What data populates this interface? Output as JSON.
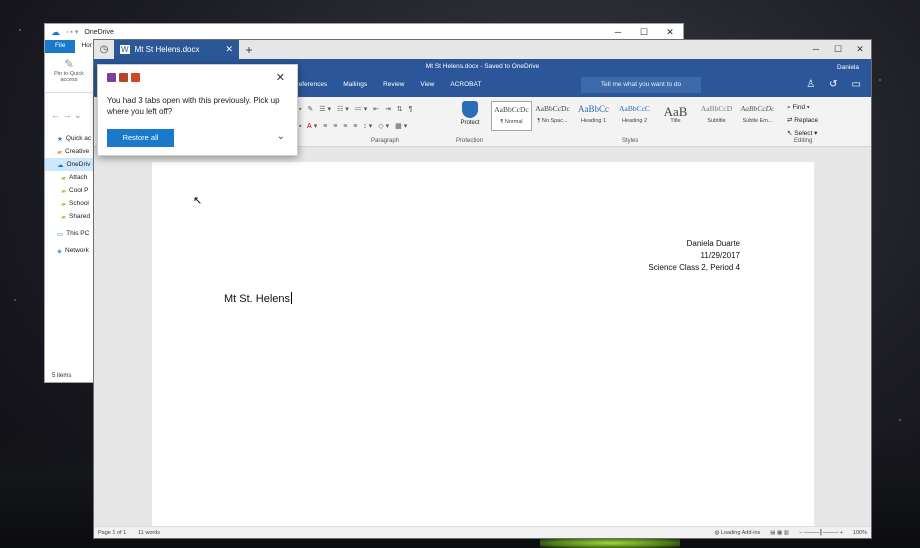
{
  "explorer": {
    "title": "OneDrive",
    "tab_file": "File",
    "tab_home": "Hor",
    "pin_label": "Pin to Quick access",
    "sidebar": [
      {
        "label": "Quick ac",
        "icon": "star-icon"
      },
      {
        "label": "Creative",
        "icon": "folder-icon"
      },
      {
        "label": "OneDriv",
        "icon": "cloud-icon",
        "selected": true
      },
      {
        "label": "Attach",
        "icon": "folder-icon"
      },
      {
        "label": "Cool P",
        "icon": "folder-icon"
      },
      {
        "label": "School",
        "icon": "folder-icon"
      },
      {
        "label": "Shared",
        "icon": "folder-icon"
      },
      {
        "label": "This PC",
        "icon": "pc-icon"
      },
      {
        "label": "Network",
        "icon": "network-icon"
      }
    ],
    "status": "5 items"
  },
  "word": {
    "tab_title": "Mt St Helens.docx",
    "doc_title": "Mt St Helens.docx - Saved to OneDrive",
    "user": "Daniela",
    "menus": [
      "References",
      "Mailings",
      "Review",
      "View",
      "ACROBAT"
    ],
    "tellme": "Tell me what you want to do",
    "groups": {
      "paragraph": "Paragraph",
      "protection": "Protection",
      "styles": "Styles",
      "editing": "Editing"
    },
    "protect_label": "Protect",
    "styles": [
      {
        "preview": "AaBbCcDc",
        "name": "¶ Normal"
      },
      {
        "preview": "AaBbCcDc",
        "name": "¶ No Spac..."
      },
      {
        "preview": "AaBbCc",
        "name": "Heading 1"
      },
      {
        "preview": "AaBbCcC",
        "name": "Heading 2"
      },
      {
        "preview": "AaB",
        "name": "Title"
      },
      {
        "preview": "AaBbCcD",
        "name": "Subtitle"
      },
      {
        "preview": "AaBbCcDc",
        "name": "Subtle Em..."
      }
    ],
    "editing": {
      "find": "Find",
      "replace": "Replace",
      "select": "Select"
    },
    "document": {
      "author": "Daniela Duarte",
      "date": "11/29/2017",
      "class": "Science Class 2, Period 4",
      "heading": "Mt St. Helens"
    },
    "status": {
      "page": "Page 1 of 1",
      "words": "11 words",
      "addins": "Loading Add-ins",
      "zoom": "100%"
    }
  },
  "popup": {
    "message": "You had 3 tabs open with this previously. Pick up where you left off?",
    "button": "Restore all"
  },
  "colors": {
    "word_blue": "#2b579a",
    "accent": "#1979ca"
  }
}
